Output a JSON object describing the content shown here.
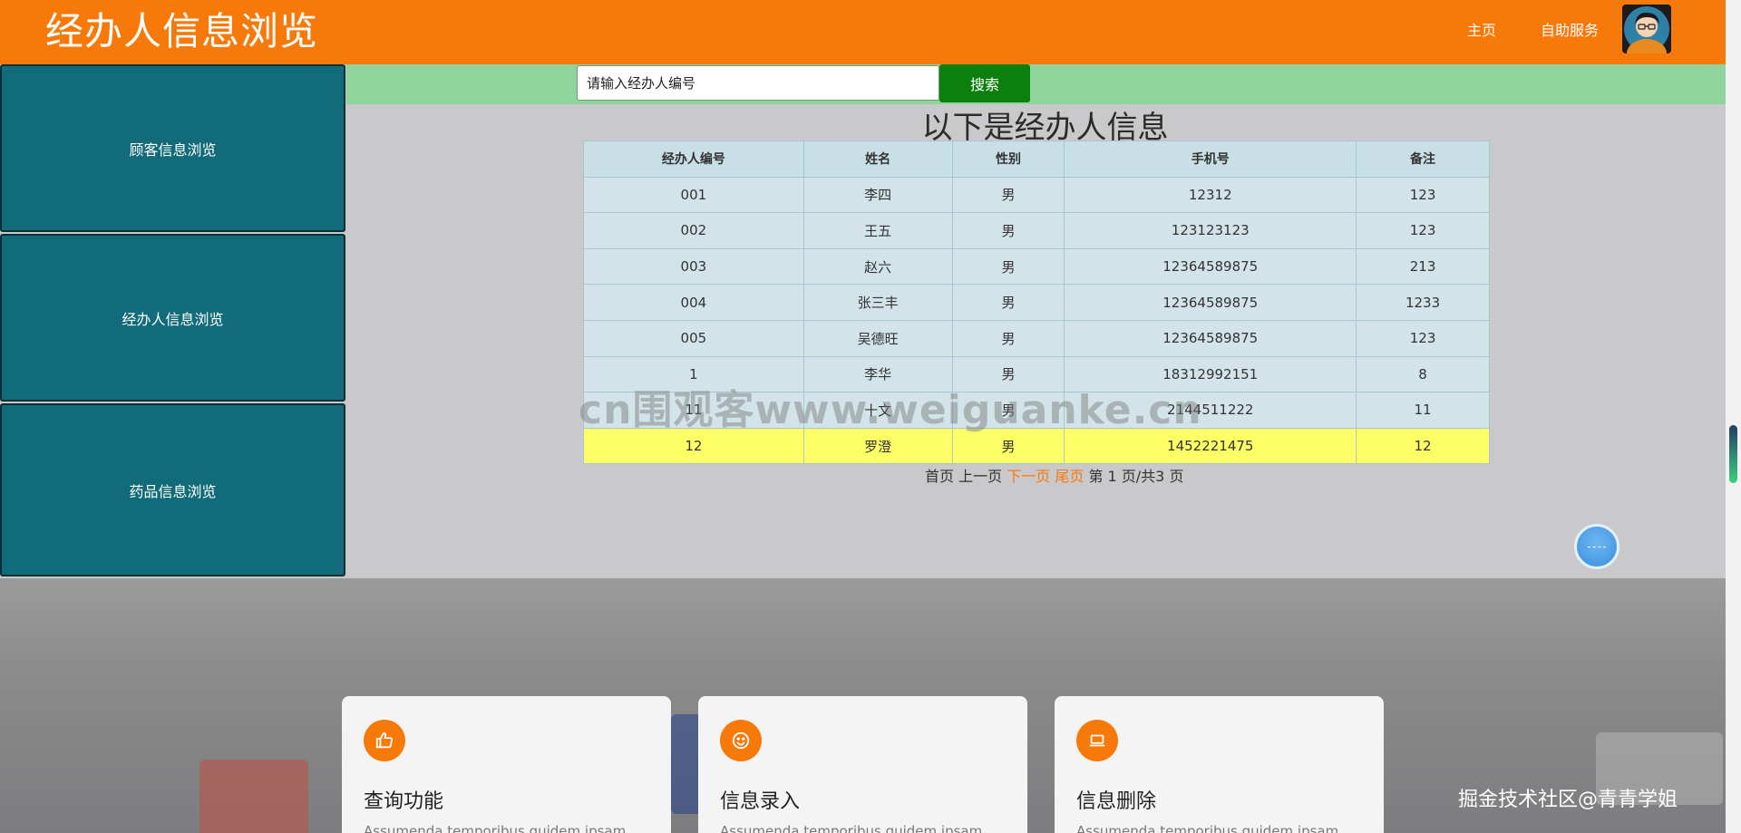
{
  "header": {
    "title": "经办人信息浏览",
    "nav_home": "主页",
    "nav_self_service": "自助服务"
  },
  "sidebar": {
    "items": [
      {
        "label": "顾客信息浏览"
      },
      {
        "label": "经办人信息浏览"
      },
      {
        "label": "药品信息浏览"
      }
    ]
  },
  "search": {
    "placeholder": "请输入经办人编号",
    "button_label": "搜索"
  },
  "main": {
    "heading": "以下是经办人信息"
  },
  "table": {
    "columns": [
      "经办人编号",
      "姓名",
      "性别",
      "手机号",
      "备注"
    ],
    "rows": [
      [
        "001",
        "李四",
        "男",
        "12312",
        "123"
      ],
      [
        "002",
        "王五",
        "男",
        "123123123",
        "123"
      ],
      [
        "003",
        "赵六",
        "男",
        "12364589875",
        "213"
      ],
      [
        "004",
        "张三丰",
        "男",
        "12364589875",
        "1233"
      ],
      [
        "005",
        "吴德旺",
        "男",
        "12364589875",
        "123"
      ],
      [
        "1",
        "李华",
        "男",
        "18312992151",
        "8"
      ],
      [
        "11",
        "十文",
        "男",
        "2144511222",
        "11"
      ],
      [
        "12",
        "罗澄",
        "男",
        "1452221475",
        "12"
      ]
    ],
    "highlighted_row": 7
  },
  "pager": {
    "first": "首页",
    "prev": "上一页",
    "next": "下一页",
    "last": "尾页",
    "status": "第 1 页/共3 页"
  },
  "features": [
    {
      "icon": "thumbs-up-icon",
      "title": "查询功能",
      "desc": "Assumenda temporibus quidem ipsam"
    },
    {
      "icon": "smile-icon",
      "title": "信息录入",
      "desc": "Assumenda temporibus quidem ipsam"
    },
    {
      "icon": "laptop-icon",
      "title": "信息删除",
      "desc": "Assumenda temporibus quidem ipsam"
    }
  ],
  "watermarks": {
    "center": "cn围观客www.weiguanke.cn",
    "corner": "掘金技术社区@青青学姐"
  },
  "colors": {
    "header_bg": "#f7790a",
    "sidebar_bg": "#126b79",
    "search_strip_bg": "#8fd39d",
    "search_button_bg": "#0c7f0c",
    "table_header_bg": "#c8dfe5",
    "table_row_bg": "#d2e4e9",
    "highlight_row_bg": "#ffff66",
    "pager_active": "#f7790a"
  }
}
